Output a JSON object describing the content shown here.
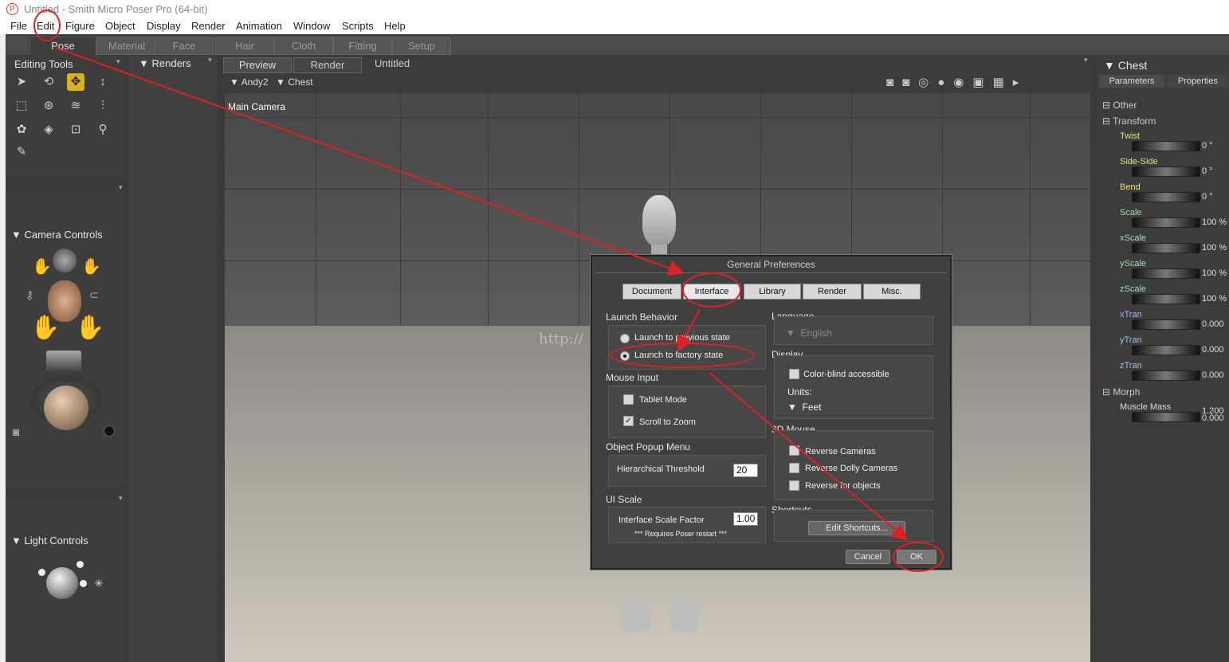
{
  "window": {
    "title": "Untitled - Smith Micro Poser Pro  (64-bit)"
  },
  "menu": [
    "File",
    "Edit",
    "Figure",
    "Object",
    "Display",
    "Render",
    "Animation",
    "Window",
    "Scripts",
    "Help"
  ],
  "rooms": [
    "Pose",
    "Material",
    "Face",
    "Hair",
    "Cloth",
    "Fitting",
    "Setup"
  ],
  "left": {
    "editing_tools": "Editing Tools",
    "camera_controls": "Camera Controls",
    "light_controls": "Light Controls"
  },
  "renders_panel": {
    "title": "Renders"
  },
  "doc": {
    "tabs": [
      "Preview",
      "Render"
    ],
    "doc_title": "Untitled",
    "figure": "Andy2",
    "part": "Chest",
    "camera": "Main Camera"
  },
  "dialog": {
    "title": "General Preferences",
    "tabs": [
      "Document",
      "Interface",
      "Library",
      "Render",
      "Misc."
    ],
    "launch": {
      "label": "Launch Behavior",
      "opt1": "Launch to previous state",
      "opt2": "Launch to factory state"
    },
    "mouse": {
      "label": "Mouse Input",
      "tablet": "Tablet Mode",
      "scroll": "Scroll to Zoom"
    },
    "popup": {
      "label": "Object Popup Menu",
      "threshold_label": "Hierarchical Threshold",
      "threshold": "20"
    },
    "uiscale": {
      "label": "UI Scale",
      "factor_label": "Interface Scale Factor",
      "factor": "1.00",
      "note": "*** Requires Poser restart ***"
    },
    "language": {
      "label": "Language",
      "value": "English"
    },
    "display": {
      "label": "Display",
      "colorblind": "Color-blind accessible",
      "units_label": "Units:",
      "units": "Feet"
    },
    "mouse3d": {
      "label": "3D Mouse",
      "opt1": "Reverse Cameras",
      "opt2": "Reverse Dolly Cameras",
      "opt3": "Reverse for objects"
    },
    "shortcuts": {
      "label": "Shortcuts",
      "button": "Edit Shortcuts..."
    },
    "cancel": "Cancel",
    "ok": "OK"
  },
  "watermark": "http://",
  "right": {
    "title": "Chest",
    "tabs": [
      "Parameters",
      "Properties"
    ],
    "groups": {
      "other": "Other",
      "transform": "Transform",
      "morph": "Morph"
    },
    "params": [
      {
        "name": "Twist",
        "value": "0 °"
      },
      {
        "name": "Side-Side",
        "value": "0 °"
      },
      {
        "name": "Bend",
        "value": "0 °"
      },
      {
        "name": "Scale",
        "value": "100 %"
      },
      {
        "name": "xScale",
        "value": "100 %"
      },
      {
        "name": "yScale",
        "value": "100 %"
      },
      {
        "name": "zScale",
        "value": "100 %"
      },
      {
        "name": "xTran",
        "value": "0.000"
      },
      {
        "name": "yTran",
        "value": "0.000"
      },
      {
        "name": "zTran",
        "value": "0.000"
      }
    ],
    "morph": {
      "name": "Muscle Mass",
      "value_top": "1.200",
      "value_bottom": "0.000"
    }
  },
  "colors": {
    "param_name_yellow": "#e8e070",
    "param_name_green": "#9fe09f",
    "annotation_red": "#e02020"
  }
}
